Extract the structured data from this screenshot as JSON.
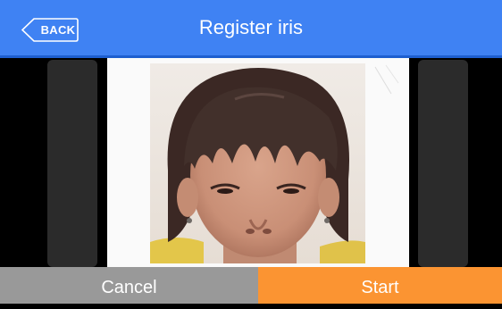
{
  "header": {
    "back_label": "BACK",
    "title": "Register iris"
  },
  "footer": {
    "cancel_label": "Cancel",
    "start_label": "Start"
  },
  "colors": {
    "header": "#3f82f3",
    "cancel": "#999999",
    "start": "#fb9432"
  }
}
